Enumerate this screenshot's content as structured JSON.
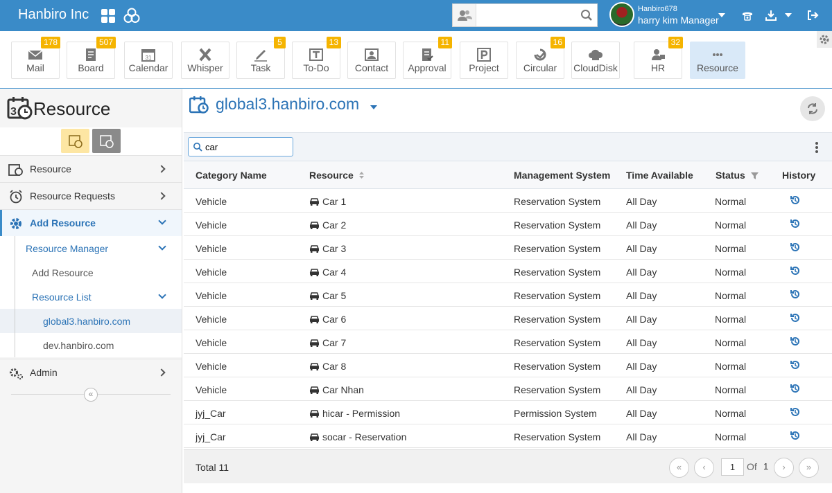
{
  "brand": "Hanbiro Inc",
  "header": {
    "search_placeholder": "",
    "username": "Hanbiro678",
    "user_role": "harry kim Manager"
  },
  "modules": [
    {
      "label": "Mail",
      "badge": "178",
      "icon": "mail-icon"
    },
    {
      "label": "Board",
      "badge": "507",
      "icon": "board-icon"
    },
    {
      "label": "Calendar",
      "badge": "",
      "icon": "calendar-icon"
    },
    {
      "label": "Whisper",
      "badge": "",
      "icon": "whisper-icon"
    },
    {
      "label": "Task",
      "badge": "5",
      "icon": "task-icon"
    },
    {
      "label": "To-Do",
      "badge": "13",
      "icon": "todo-icon"
    },
    {
      "label": "Contact",
      "badge": "",
      "icon": "contact-icon"
    },
    {
      "label": "Approval",
      "badge": "11",
      "icon": "approval-icon"
    },
    {
      "label": "Project",
      "badge": "",
      "icon": "project-icon"
    },
    {
      "label": "Circular",
      "badge": "16",
      "icon": "circular-icon"
    },
    {
      "label": "CloudDisk",
      "badge": "",
      "icon": "clouddisk-icon"
    },
    {
      "label": "HR",
      "badge": "32",
      "icon": "hr-icon"
    },
    {
      "label": "Resource",
      "badge": "",
      "icon": "more-icon"
    }
  ],
  "sidebar": {
    "title": "Resource",
    "items": [
      {
        "label": "Resource"
      },
      {
        "label": "Resource Requests"
      },
      {
        "label": "Add Resource"
      },
      {
        "label": "Resource Manager"
      },
      {
        "label": "Add Resource"
      },
      {
        "label": "Resource List"
      },
      {
        "label": "global3.hanbiro.com"
      },
      {
        "label": "dev.hanbiro.com"
      },
      {
        "label": "Admin"
      }
    ],
    "collapse_label": "«"
  },
  "main": {
    "title": "global3.hanbiro.com",
    "filter_value": "car",
    "columns": {
      "category": "Category Name",
      "resource": "Resource",
      "management": "Management System",
      "time": "Time Available",
      "status": "Status",
      "history": "History"
    },
    "rows": [
      {
        "category": "Vehicle",
        "resource": "Car 1",
        "management": "Reservation System",
        "time": "All Day",
        "status": "Normal"
      },
      {
        "category": "Vehicle",
        "resource": "Car 2",
        "management": "Reservation System",
        "time": "All Day",
        "status": "Normal"
      },
      {
        "category": "Vehicle",
        "resource": "Car 3",
        "management": "Reservation System",
        "time": "All Day",
        "status": "Normal"
      },
      {
        "category": "Vehicle",
        "resource": "Car 4",
        "management": "Reservation System",
        "time": "All Day",
        "status": "Normal"
      },
      {
        "category": "Vehicle",
        "resource": "Car 5",
        "management": "Reservation System",
        "time": "All Day",
        "status": "Normal"
      },
      {
        "category": "Vehicle",
        "resource": "Car 6",
        "management": "Reservation System",
        "time": "All Day",
        "status": "Normal"
      },
      {
        "category": "Vehicle",
        "resource": "Car 7",
        "management": "Reservation System",
        "time": "All Day",
        "status": "Normal"
      },
      {
        "category": "Vehicle",
        "resource": "Car 8",
        "management": "Reservation System",
        "time": "All Day",
        "status": "Normal"
      },
      {
        "category": "Vehicle",
        "resource": "Car Nhan",
        "management": "Reservation System",
        "time": "All Day",
        "status": "Normal"
      },
      {
        "category": "jyj_Car",
        "resource": "hicar - Permission",
        "management": "Permission System",
        "time": "All Day",
        "status": "Normal"
      },
      {
        "category": "jyj_Car",
        "resource": "socar - Reservation",
        "management": "Reservation System",
        "time": "All Day",
        "status": "Normal"
      }
    ],
    "footer": {
      "total": "Total 11",
      "page": "1",
      "of_label": "Of",
      "pages": "1"
    }
  },
  "colors": {
    "primary": "#3a8bc8",
    "accent_text": "#2b73b6",
    "badge": "#f5b400"
  }
}
